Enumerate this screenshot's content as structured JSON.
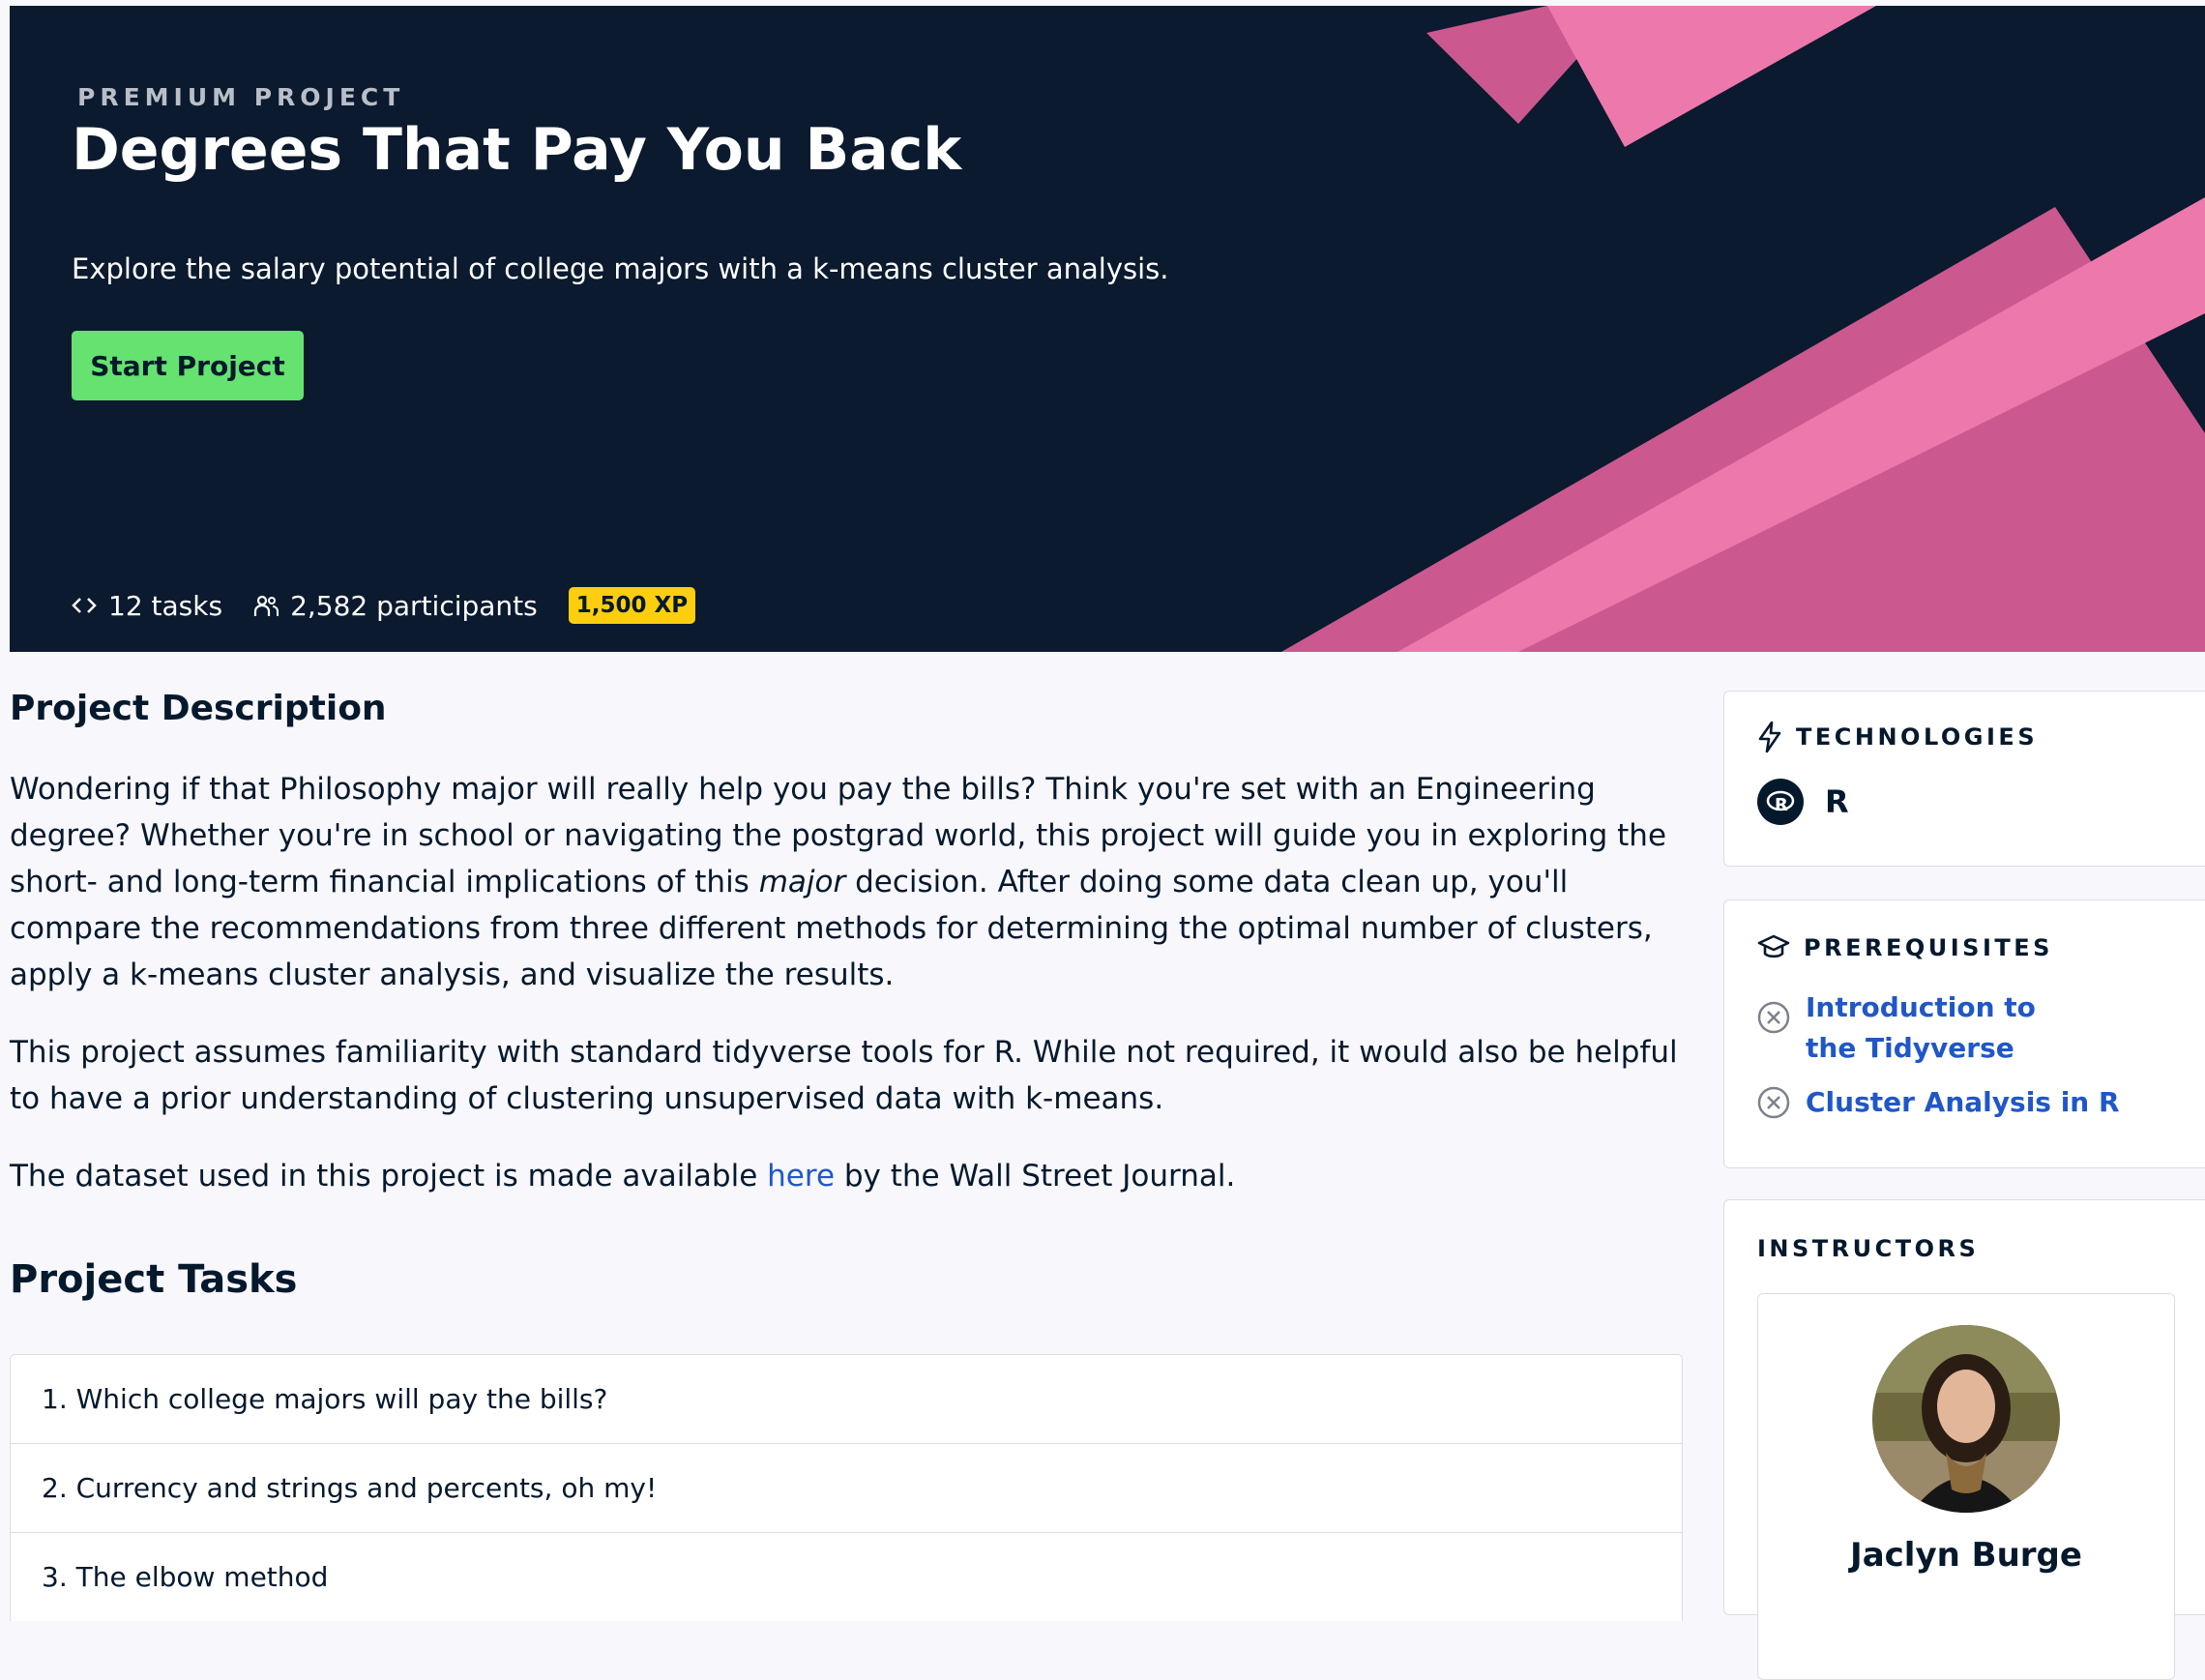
{
  "hero": {
    "eyebrow": "PREMIUM PROJECT",
    "title": "Degrees That Pay You Back",
    "subtitle": "Explore the salary potential of college majors with a k-means cluster analysis.",
    "start_button": "Start Project",
    "tasks_count": "12 tasks",
    "participants": "2,582 participants",
    "xp": "1,500 XP",
    "colors": {
      "background": "#0b1a2e",
      "pink_dark": "#cc5890",
      "pink_light": "#ed78ac",
      "button": "#65e26f",
      "xp_badge": "#fcce0d"
    }
  },
  "description": {
    "heading": "Project Description",
    "p1_a": "Wondering if that Philosophy major will really help you pay the bills? Think you're set with an Engineering degree? Whether you're in school or navigating the postgrad world, this project will guide you in exploring the short- and long-term financial implications of this ",
    "p1_em": "major",
    "p1_b": " decision. After doing some data clean up, you'll compare the recommendations from three different methods for determining the optimal number of clusters, apply a k-means cluster analysis, and visualize the results.",
    "p2": "This project assumes familiarity with standard tidyverse tools for R. While not required, it would also be helpful to have a prior understanding of clustering unsupervised data with k-means.",
    "p3_a": "The dataset used in this project is made available ",
    "p3_link": "here",
    "p3_b": " by the Wall Street Journal."
  },
  "tasks": {
    "heading": "Project Tasks",
    "items": [
      "1. Which college majors will pay the bills?",
      "2. Currency and strings and percents, oh my!",
      "3. The elbow method"
    ]
  },
  "sidebar": {
    "technologies": {
      "heading": "TECHNOLOGIES",
      "icon": "bolt-icon",
      "items": [
        "R"
      ]
    },
    "prerequisites": {
      "heading": "PREREQUISITES",
      "icon": "graduation-cap-icon",
      "items": [
        "Introduction to the Tidyverse",
        "Cluster Analysis in R"
      ]
    },
    "instructors": {
      "heading": "INSTRUCTORS",
      "name": "Jaclyn Burge"
    }
  }
}
